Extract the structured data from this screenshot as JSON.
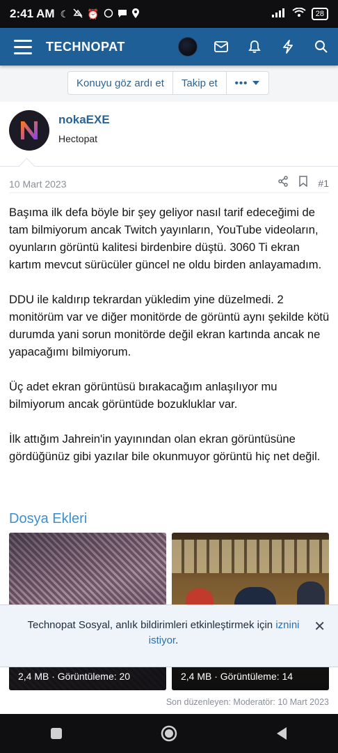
{
  "status_bar": {
    "time": "2:41 AM",
    "battery": "28",
    "icons": [
      "moon-icon",
      "mute-icon",
      "alarm-icon",
      "whatsapp-icon",
      "chat-icon",
      "location-icon",
      "signal-icon",
      "wifi-icon",
      "battery-icon"
    ]
  },
  "header": {
    "logo": "TECHNOPAT",
    "icons": [
      "menu-icon",
      "avatar",
      "mail-icon",
      "bell-icon",
      "bolt-icon",
      "search-icon"
    ],
    "color": "#1f5f98"
  },
  "thread_actions": {
    "ignore": "Konuyu göz ardı et",
    "follow": "Takip et",
    "more": "•••"
  },
  "post": {
    "username": "nokaEXE",
    "user_title": "Hectopat",
    "date": "10 Mart 2023",
    "post_number": "#1",
    "paragraphs": [
      "Başıma ilk defa böyle bir şey geliyor nasıl tarif edeceğimi de tam bilmiyorum ancak Twitch yayınların, YouTube videoların, oyunların görüntü kalitesi birdenbire düştü. 3060 Ti ekran kartım mevcut sürücüler güncel ne oldu birden anlayamadım.",
      "DDU ile kaldırıp tekrardan yükledim yine düzelmedi. 2 monitörüm var ve diğer monitörde de görüntü aynı şekilde kötü durumda yani sorun monitörde değil ekran kartında ancak ne yapacağımı bilmiyorum.",
      "Üç adet ekran görüntüsü bırakacağım anlaşılıyor mu bilmiyorum ancak görüntüde bozukluklar var.",
      "İlk attığım Jahrein'in yayınından olan ekran görüntüsüne gördüğünüz gibi yazılar bile okunmuyor görüntü hiç net değil."
    ],
    "attachments_title": "Dosya Ekleri",
    "attachments": [
      {
        "caption": "2,4 MB · Görüntüleme: 20"
      },
      {
        "caption": "2,4 MB · Görüntüleme: 14"
      }
    ],
    "edited": "Son düzenleyen: Moderatör: 10 Mart 2023"
  },
  "notice": {
    "text": "Technopat Sosyal, anlık bildirimleri etkinleştirmek için ",
    "link": "iznini istiyor",
    "suffix": "."
  }
}
